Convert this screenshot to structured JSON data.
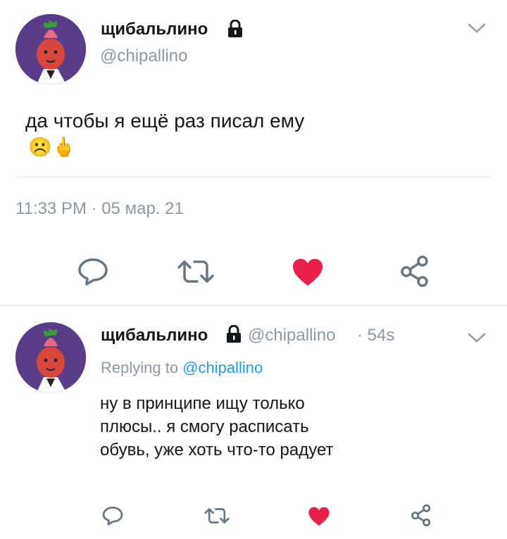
{
  "main_tweet": {
    "display_name": "щибальлино",
    "handle": "@chipallino",
    "text": "да чтобы я ещё раз писал ему",
    "emoji": "☹️🖕",
    "timestamp": "11:33 PM · 05 мар. 21"
  },
  "reply_tweet": {
    "display_name": "щибальлино",
    "handle": "@chipallino",
    "time_ago": "· 54s",
    "replying_label": "Replying to",
    "replying_handle": "@chipallino",
    "text_lines": [
      "ну в принципе ищу только",
      "плюсы.. я смогу расписать",
      "обувь, уже хоть что-то радует"
    ]
  },
  "colors": {
    "like_red": "#e8204a",
    "icon_gray": "#667785",
    "link_blue": "#1d9bf0",
    "muted_text": "#8c98a5"
  },
  "icons": [
    "lock-icon",
    "chevron-down-icon",
    "reply-icon",
    "retweet-icon",
    "like-heart-icon",
    "share-icon"
  ]
}
